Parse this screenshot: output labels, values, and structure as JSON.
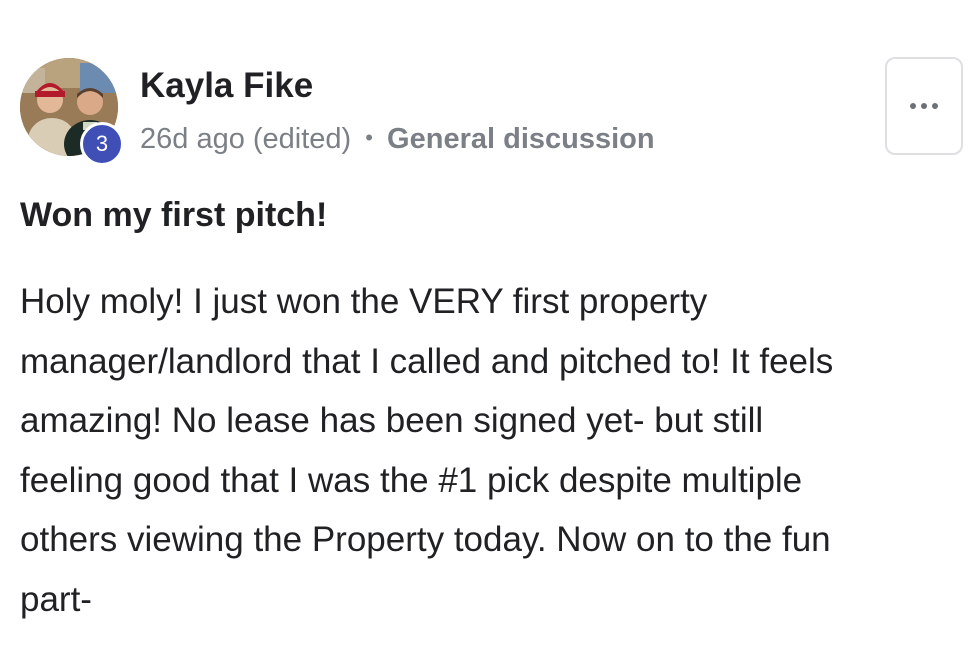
{
  "post": {
    "author": {
      "name": "Kayla Fike",
      "level": "3",
      "avatar_icon": "profile-photo"
    },
    "meta": {
      "time": "26d ago",
      "edited": "(edited)",
      "separator": "•",
      "category": "General discussion"
    },
    "more_icon": "more-horizontal-icon",
    "title": "Won my first pitch!",
    "body": "Holy moly! I just won the VERY first property\nmanager/landlord that I called and pitched to! It feels\namazing! No lease has been signed yet- but still\nfeeling good that I was the #1 pick despite multiple\nothers viewing the Property today. Now on to the fun\npart-"
  },
  "colors": {
    "text": "#202124",
    "muted": "#7b7f86",
    "badge": "#3f4fb5",
    "border": "#dedfe2"
  }
}
